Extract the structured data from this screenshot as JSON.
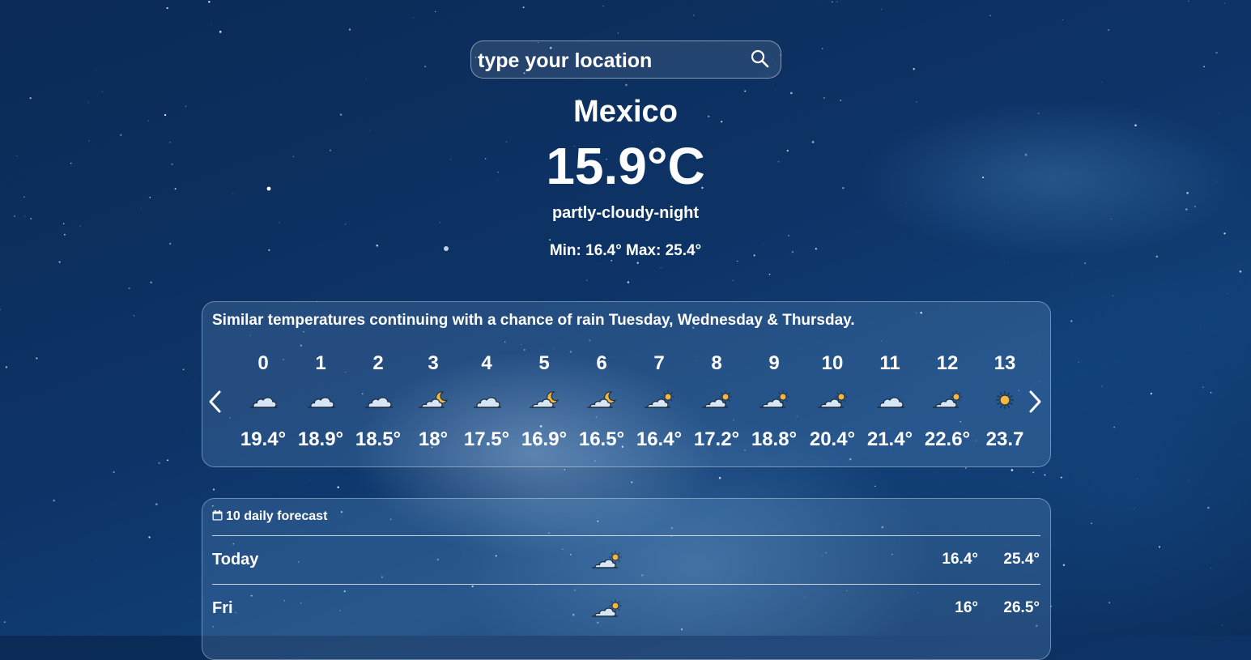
{
  "search": {
    "placeholder": "type your location",
    "icon": "search-icon"
  },
  "current": {
    "city": "Mexico",
    "temperature": "15.9°C",
    "condition": "partly-cloudy-night",
    "minmax": "Min: 16.4° Max: 25.4°"
  },
  "hourly": {
    "summary": "Similar temperatures continuing with a chance of rain Tuesday, Wednesday & Thursday.",
    "prev_icon": "chevron-left-icon",
    "next_icon": "chevron-right-icon",
    "items": [
      {
        "hour": "0",
        "icon": "cloudy",
        "temp": "19.4°"
      },
      {
        "hour": "1",
        "icon": "cloudy",
        "temp": "18.9°"
      },
      {
        "hour": "2",
        "icon": "cloudy",
        "temp": "18.5°"
      },
      {
        "hour": "3",
        "icon": "partly-cloudy-night",
        "temp": "18°"
      },
      {
        "hour": "4",
        "icon": "cloudy",
        "temp": "17.5°"
      },
      {
        "hour": "5",
        "icon": "partly-cloudy-night",
        "temp": "16.9°"
      },
      {
        "hour": "6",
        "icon": "partly-cloudy-night",
        "temp": "16.5°"
      },
      {
        "hour": "7",
        "icon": "partly-cloudy-day",
        "temp": "16.4°"
      },
      {
        "hour": "8",
        "icon": "partly-cloudy-day",
        "temp": "17.2°"
      },
      {
        "hour": "9",
        "icon": "partly-cloudy-day",
        "temp": "18.8°"
      },
      {
        "hour": "10",
        "icon": "partly-cloudy-day",
        "temp": "20.4°"
      },
      {
        "hour": "11",
        "icon": "cloudy",
        "temp": "21.4°"
      },
      {
        "hour": "12",
        "icon": "partly-cloudy-day",
        "temp": "22.6°"
      },
      {
        "hour": "13",
        "icon": "clear-day",
        "temp": "23.7"
      }
    ]
  },
  "daily": {
    "title": "10 daily forecast",
    "title_icon": "calendar-icon",
    "rows": [
      {
        "day": "Today",
        "icon": "partly-cloudy-day",
        "min": "16.4°",
        "max": "25.4°"
      },
      {
        "day": "Fri",
        "icon": "partly-cloudy-day",
        "min": "16°",
        "max": "26.5°"
      }
    ]
  },
  "colors": {
    "card_border": "#9fbbd8",
    "sun": "#f5b642",
    "moon": "#f5b642",
    "cloud": "#d7e6f5",
    "outline": "#1a2a3a"
  }
}
